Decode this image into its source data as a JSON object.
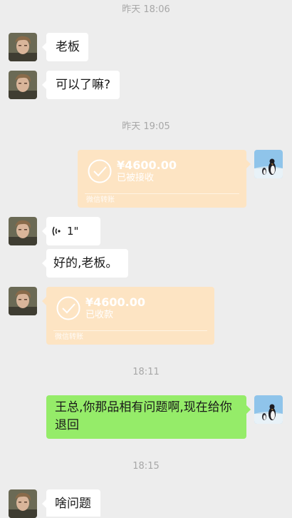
{
  "messages": {
    "ts1": "昨天 18:06",
    "m1": "老板",
    "m2": "可以了嘛?",
    "ts2": "昨天 19:05",
    "transfer1": {
      "amount": "¥4600.00",
      "status": "已被接收",
      "footer": "微信转账"
    },
    "voice": {
      "duration": "1\""
    },
    "m3": "好的,老板。",
    "transfer2": {
      "amount": "¥4600.00",
      "status": "已收款",
      "footer": "微信转账"
    },
    "ts3": "18:11",
    "m4": "王总,你那品相有问题啊,现在给你退回",
    "ts4": "18:15",
    "m5": "啥问题"
  },
  "icons": {
    "transfer": "check-circle-icon",
    "voice": "voice-wave-icon",
    "avatar_other": "person-photo",
    "avatar_self": "penguin-photo"
  },
  "colors": {
    "background": "#ededed",
    "bubble_self": "#95ec69",
    "bubble_other": "#ffffff",
    "transfer": "#fde4c3"
  }
}
